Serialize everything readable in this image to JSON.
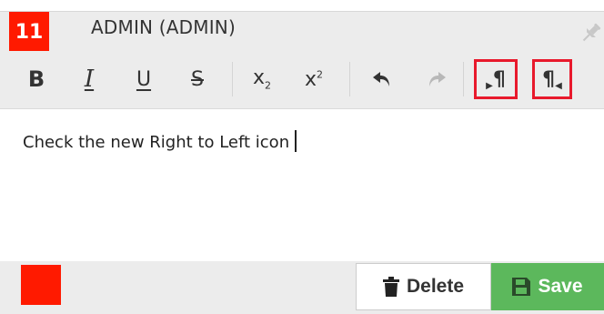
{
  "header": {
    "number": "11",
    "author": "ADMIN (ADMIN)",
    "pin_icon": "pin-icon"
  },
  "toolbar": {
    "buttons": [
      {
        "name": "bold",
        "icon": "bold-icon"
      },
      {
        "name": "italic",
        "icon": "italic-icon"
      },
      {
        "name": "underline",
        "icon": "underline-icon"
      },
      {
        "name": "strikethrough",
        "icon": "strikethrough-icon"
      },
      {
        "name": "subscript",
        "icon": "subscript-icon"
      },
      {
        "name": "superscript",
        "icon": "superscript-icon"
      },
      {
        "name": "undo",
        "icon": "undo-icon"
      },
      {
        "name": "redo",
        "icon": "redo-icon"
      },
      {
        "name": "ltr",
        "icon": "paragraph-ltr-icon"
      },
      {
        "name": "rtl",
        "icon": "paragraph-rtl-icon"
      }
    ]
  },
  "editor": {
    "text": "Check the new Right to Left icon"
  },
  "footer": {
    "swatch_color": "#ff1a00",
    "delete_label": "Delete",
    "save_label": "Save"
  },
  "colors": {
    "accent_red": "#ff1a00",
    "highlight_red": "#e8192c",
    "save_green": "#5cb85c"
  }
}
